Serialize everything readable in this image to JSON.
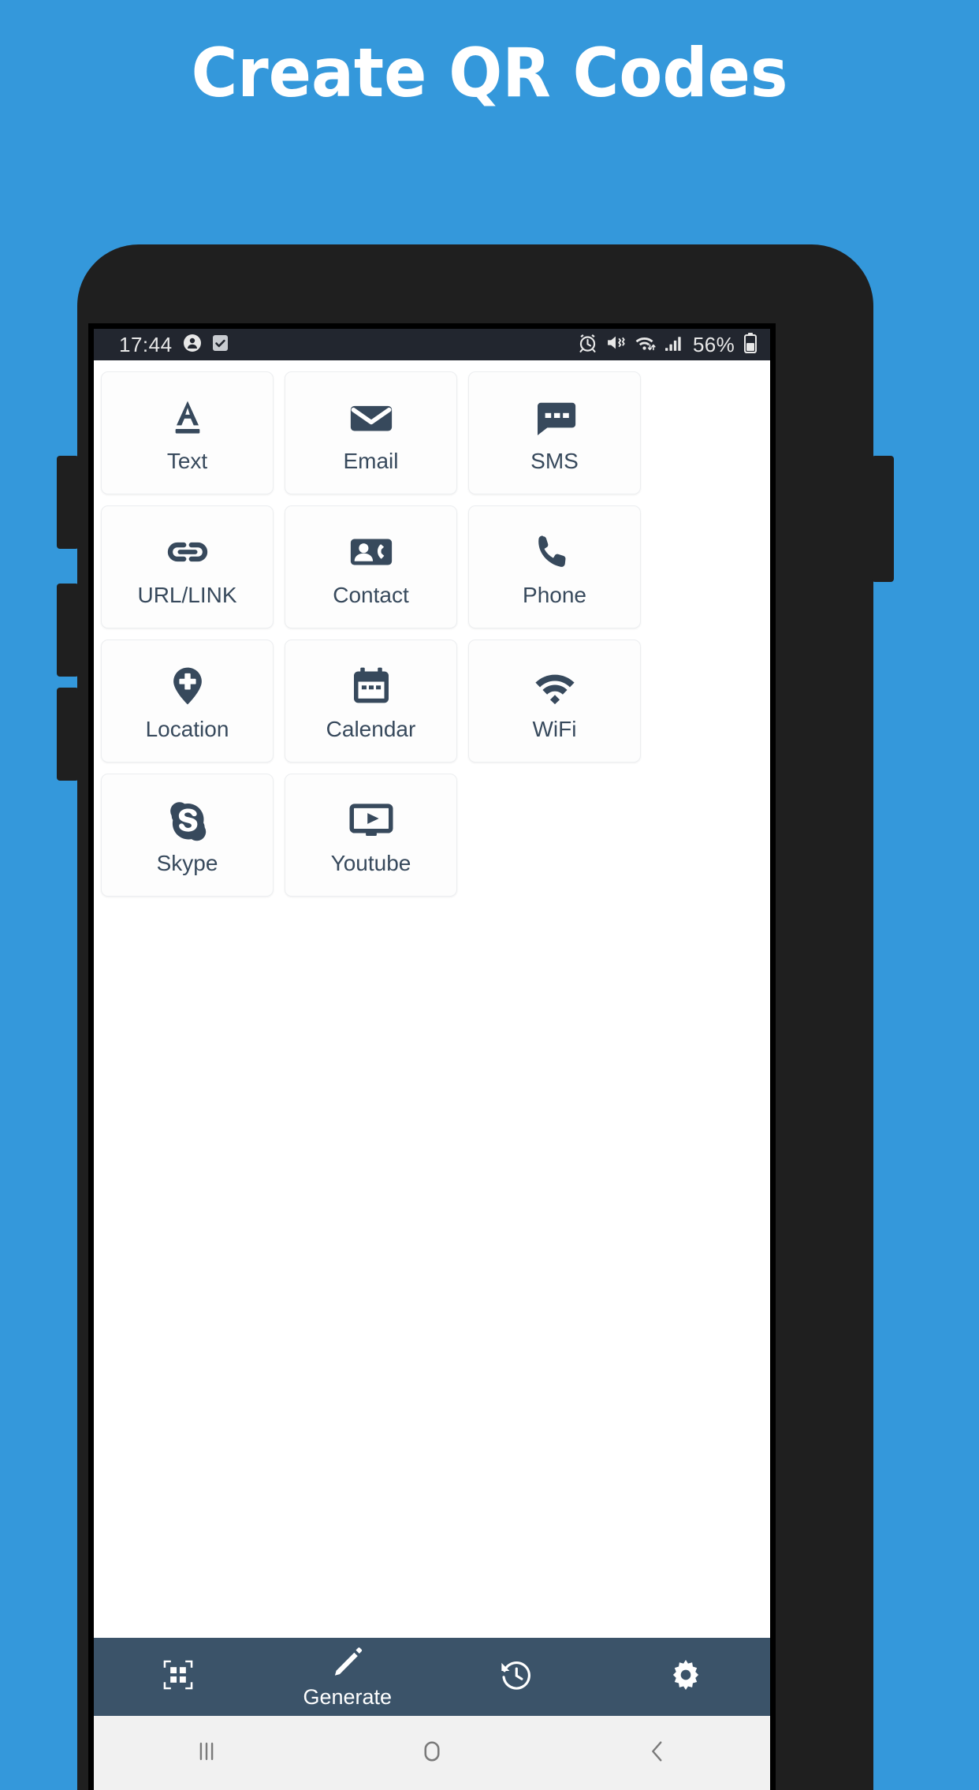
{
  "promo": {
    "headline": "Create QR Codes",
    "background_color": "#3498db",
    "headline_color": "#ffffff"
  },
  "theme": {
    "icon_color": "#37495c",
    "nav_bar_color": "#3b5369",
    "status_bar_color": "#22262f",
    "tile_background": "#fdfdfd",
    "screen_background": "#ffffff"
  },
  "status_bar": {
    "time": "17:44",
    "battery_percent": "56%",
    "left_icons": [
      "person-icon",
      "checkbox-checked-icon"
    ],
    "right_icons": [
      "alarm-icon",
      "mute-vibrate-icon",
      "wifi-transfer-icon",
      "signal-bars-icon",
      "battery-icon"
    ]
  },
  "app": {
    "title": "Generate",
    "tiles": [
      {
        "label": "Text",
        "icon": "text-a-underline-icon"
      },
      {
        "label": "Email",
        "icon": "envelope-icon"
      },
      {
        "label": "SMS",
        "icon": "speech-bubble-dots-icon"
      },
      {
        "label": "URL/LINK",
        "icon": "chain-link-icon"
      },
      {
        "label": "Contact",
        "icon": "contact-card-icon"
      },
      {
        "label": "Phone",
        "icon": "phone-handset-icon"
      },
      {
        "label": "Location",
        "icon": "map-pin-plus-icon"
      },
      {
        "label": "Calendar",
        "icon": "calendar-icon"
      },
      {
        "label": "WiFi",
        "icon": "wifi-icon"
      },
      {
        "label": "Skype",
        "icon": "skype-icon"
      },
      {
        "label": "Youtube",
        "icon": "video-play-monitor-icon"
      }
    ],
    "bottom_nav": [
      {
        "label": "",
        "icon": "qr-scan-icon",
        "active": false
      },
      {
        "label": "Generate",
        "icon": "pencil-icon",
        "active": true
      },
      {
        "label": "",
        "icon": "history-icon",
        "active": false
      },
      {
        "label": "",
        "icon": "gear-icon",
        "active": false
      }
    ]
  },
  "system_nav": {
    "buttons": [
      {
        "name": "recents",
        "icon": "recents-bars-icon"
      },
      {
        "name": "home",
        "icon": "home-circle-icon"
      },
      {
        "name": "back",
        "icon": "back-chevron-icon"
      }
    ]
  }
}
